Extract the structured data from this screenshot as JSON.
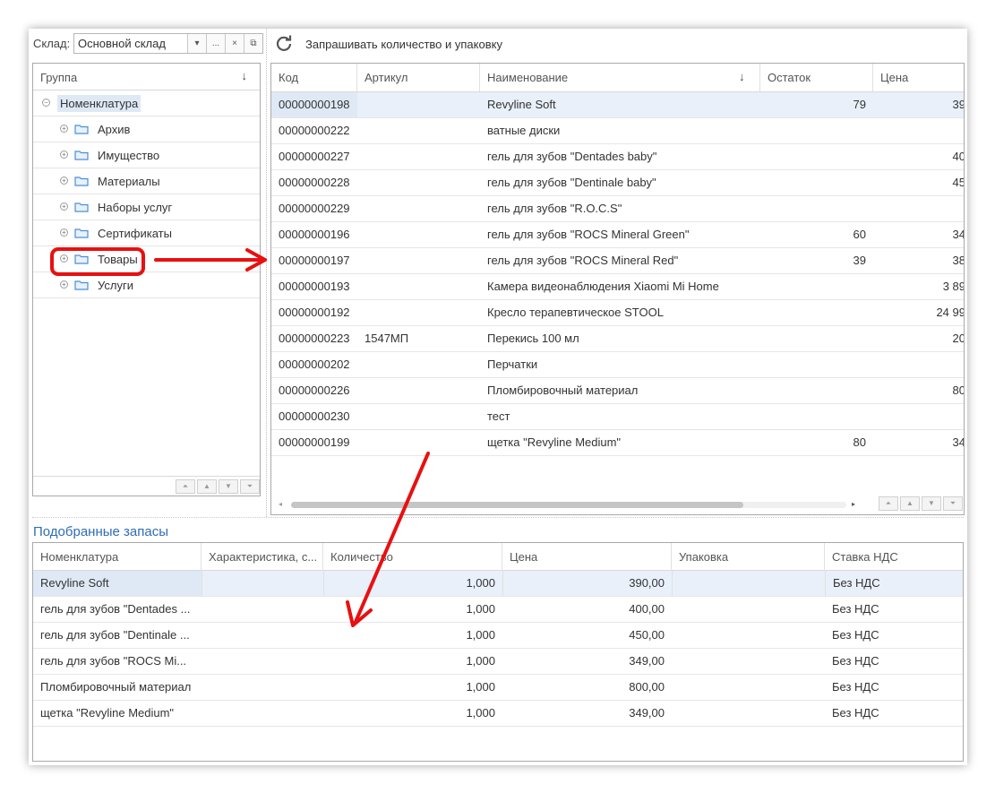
{
  "warehouse": {
    "label": "Склад:",
    "value": "Основной склад",
    "btn_dropdown": "▾",
    "btn_select": "...",
    "btn_clear": "×",
    "btn_open": "⧉"
  },
  "toolbar": {
    "refresh_icon": "refresh-icon",
    "ask_label": "Запрашивать количество и упаковку"
  },
  "groups": {
    "header": "Группа",
    "sort_icon": "↓",
    "root": "Номенклатура",
    "items": [
      "Архив",
      "Имущество",
      "Материалы",
      "Наборы услуг",
      "Сертификаты",
      "Товары",
      "Услуги"
    ],
    "highlighted": "Товары",
    "folder_color": "#4a8fd6"
  },
  "items_table": {
    "columns": [
      "Код",
      "Артикул",
      "Наименование",
      "Остаток",
      "Цена"
    ],
    "sort_icon": "↓",
    "rows": [
      {
        "code": "00000000198",
        "article": "",
        "name": "Revyline Soft",
        "stock": "79",
        "price": "39"
      },
      {
        "code": "00000000222",
        "article": "",
        "name": "ватные диски",
        "stock": "",
        "price": ""
      },
      {
        "code": "00000000227",
        "article": "",
        "name": "гель для зубов \"Dentades baby\"",
        "stock": "",
        "price": "40"
      },
      {
        "code": "00000000228",
        "article": "",
        "name": "гель для зубов \"Dentinale baby\"",
        "stock": "",
        "price": "45"
      },
      {
        "code": "00000000229",
        "article": "",
        "name": "гель для зубов \"R.O.C.S\"",
        "stock": "",
        "price": ""
      },
      {
        "code": "00000000196",
        "article": "",
        "name": "гель для зубов \"ROCS Mineral Green\"",
        "stock": "60",
        "price": "34"
      },
      {
        "code": "00000000197",
        "article": "",
        "name": "гель для зубов \"ROCS Mineral Red\"",
        "stock": "39",
        "price": "38"
      },
      {
        "code": "00000000193",
        "article": "",
        "name": "Камера видеонаблюдения Xiaomi Mi Home",
        "stock": "",
        "price": "3 89"
      },
      {
        "code": "00000000192",
        "article": "",
        "name": "Кресло терапевтическое STOOL",
        "stock": "",
        "price": "24 99"
      },
      {
        "code": "00000000223",
        "article": "1547МП",
        "name": "Перекись 100 мл",
        "stock": "",
        "price": "20"
      },
      {
        "code": "00000000202",
        "article": "",
        "name": "Перчатки",
        "stock": "",
        "price": ""
      },
      {
        "code": "00000000226",
        "article": "",
        "name": "Пломбировочный материал",
        "stock": "",
        "price": "80"
      },
      {
        "code": "00000000230",
        "article": "",
        "name": "тест",
        "stock": "",
        "price": ""
      },
      {
        "code": "00000000199",
        "article": "",
        "name": "щетка \"Revyline Medium\"",
        "stock": "80",
        "price": "34"
      }
    ]
  },
  "selected": {
    "title": "Подобранные запасы",
    "columns": [
      "Номенклатура",
      "Характеристика, с...",
      "Количество",
      "Цена",
      "Упаковка",
      "Ставка НДС"
    ],
    "rows": [
      {
        "item": "Revyline Soft",
        "char": "",
        "qty": "1,000",
        "price": "390,00",
        "pack": "",
        "vat": "Без НДС"
      },
      {
        "item": "гель для зубов \"Dentades ...",
        "char": "",
        "qty": "1,000",
        "price": "400,00",
        "pack": "",
        "vat": "Без НДС"
      },
      {
        "item": "гель для зубов \"Dentinale ...",
        "char": "",
        "qty": "1,000",
        "price": "450,00",
        "pack": "",
        "vat": "Без НДС"
      },
      {
        "item": "гель для зубов \"ROCS Mi...",
        "char": "",
        "qty": "1,000",
        "price": "349,00",
        "pack": "",
        "vat": "Без НДС"
      },
      {
        "item": "Пломбировочный материал",
        "char": "",
        "qty": "1,000",
        "price": "800,00",
        "pack": "",
        "vat": "Без НДС"
      },
      {
        "item": "щетка \"Revyline Medium\"",
        "char": "",
        "qty": "1,000",
        "price": "349,00",
        "pack": "",
        "vat": "Без НДС"
      }
    ]
  },
  "colors": {
    "accent_title": "#2f6db5",
    "annotation_red": "#e81010",
    "selection": "#e9f0fa"
  }
}
